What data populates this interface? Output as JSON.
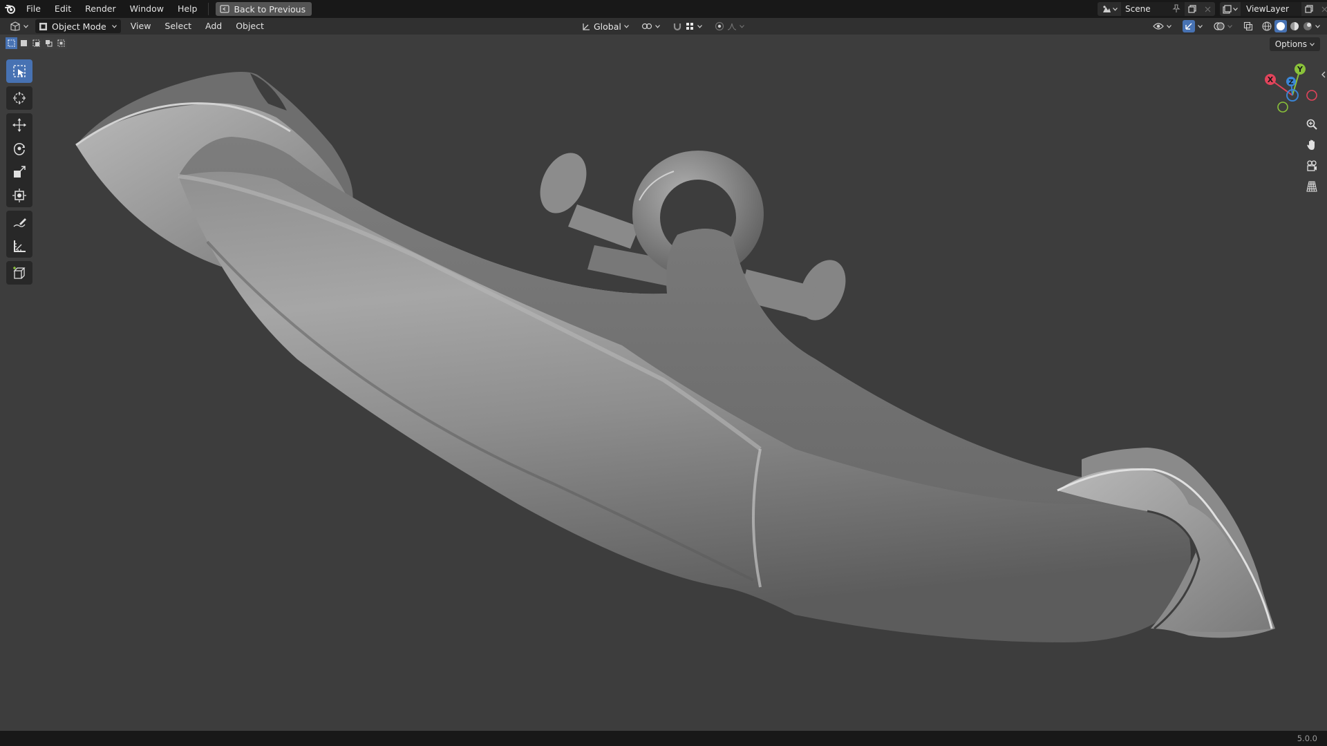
{
  "app": {
    "name": "Blender",
    "version": "5.0.0"
  },
  "topbar": {
    "menus": [
      "File",
      "Edit",
      "Render",
      "Window",
      "Help"
    ],
    "back_button": "Back to Previous",
    "scene_name": "Scene",
    "view_layer_name": "ViewLayer"
  },
  "header": {
    "mode": "Object Mode",
    "menus": [
      "View",
      "Select",
      "Add",
      "Object"
    ],
    "transform_orientation": "Global"
  },
  "viewport": {
    "options_label": "Options",
    "gizmo": {
      "x_label": "X",
      "y_label": "Y",
      "z_label": "Z"
    },
    "shading_mode": "solid"
  },
  "toolbar": {
    "tools": [
      "select-box",
      "cursor",
      "move",
      "rotate",
      "scale",
      "transform",
      "annotate",
      "measure",
      "add-cube"
    ],
    "active_tool": "select-box"
  },
  "colors": {
    "accent": "#4772b3",
    "axis_x": "#e2445b",
    "axis_y": "#8ac23a",
    "axis_z": "#3b86d6"
  }
}
